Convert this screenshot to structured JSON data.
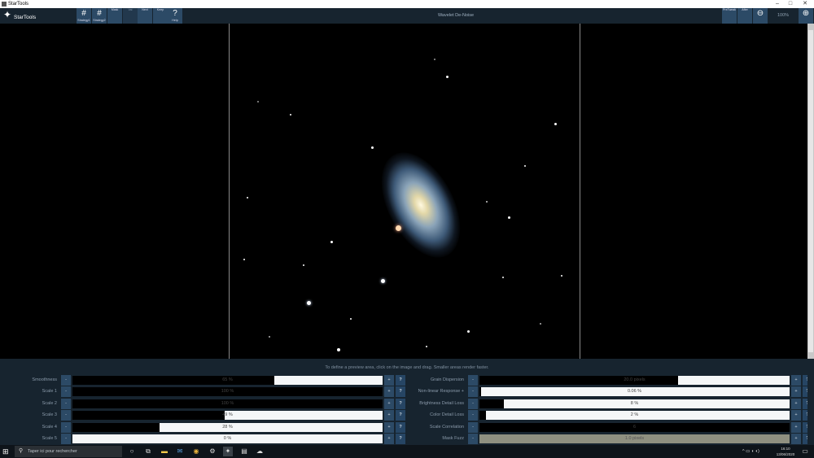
{
  "window": {
    "title": "StarTools",
    "minimize": "–",
    "restore": "□",
    "close": "✕"
  },
  "toolbar": {
    "logo_text": "StarTools",
    "module_title": "Wavelet De-Noise",
    "zoom_level": "100%",
    "buttons": [
      {
        "label": "Strategy1",
        "icon": "grid-icon",
        "glyph": "#"
      },
      {
        "label": "Strategy2",
        "icon": "grid-icon",
        "glyph": "#"
      },
      {
        "label": "Mask",
        "icon": "mask-icon",
        "glyph": ""
      },
      {
        "label": "Val",
        "icon": "blank-icon",
        "glyph": ""
      },
      {
        "label": "Next",
        "icon": "next-icon",
        "glyph": ""
      },
      {
        "label": "Keep",
        "icon": "keep-icon",
        "glyph": ""
      },
      {
        "label": "Help",
        "icon": "help-icon",
        "glyph": "?"
      }
    ],
    "right_buttons": [
      {
        "label": "PreTweak",
        "icon": "pretweak-icon",
        "glyph": ""
      },
      {
        "label": "After",
        "icon": "after-icon",
        "glyph": ""
      },
      {
        "label": "",
        "icon": "zoom-out-icon",
        "glyph": "⊖"
      },
      {
        "label": "",
        "icon": "zoom-in-icon",
        "glyph": "⊕"
      }
    ]
  },
  "hint": "To define a preview area, click on the image and drag. Smaller areas render faster.",
  "params_left": [
    {
      "label": "Smoothness",
      "value": "65 %",
      "fill": 0.65
    },
    {
      "label": "Scale 1",
      "value": "100 %",
      "fill": 1.0
    },
    {
      "label": "Scale 2",
      "value": "100 %",
      "fill": 1.0
    },
    {
      "label": "Scale 3",
      "value": "49 %",
      "fill": 0.49
    },
    {
      "label": "Scale 4",
      "value": "28 %",
      "fill": 0.28
    },
    {
      "label": "Scale 5",
      "value": "0 %",
      "fill": 0.0
    }
  ],
  "params_right": [
    {
      "label": "Grain Dispersion",
      "value": "20.0 pixels",
      "fill": 0.64,
      "dim": false
    },
    {
      "label": "Non-linear Response +",
      "value": "0.06 %",
      "fill": 0.005,
      "dim": false
    },
    {
      "label": "Brightness Detail Loss",
      "value": "8 %",
      "fill": 0.08,
      "dim": false
    },
    {
      "label": "Color Detail Loss",
      "value": "2 %",
      "fill": 0.02,
      "dim": false
    },
    {
      "label": "Scale Correlation",
      "value": "6",
      "fill": 1.0,
      "dim": false
    },
    {
      "label": "Mask Fuzz",
      "value": "1.0 pixels",
      "fill": 0.0,
      "dim": true
    }
  ],
  "controls": {
    "minus": "-",
    "plus": "+",
    "help": "?"
  },
  "taskbar": {
    "search_placeholder": "Taper ici pour rechercher",
    "time": "16:10",
    "date": "13/06/2020",
    "tray_icons": "^ ▭ ◖ ◖)"
  }
}
